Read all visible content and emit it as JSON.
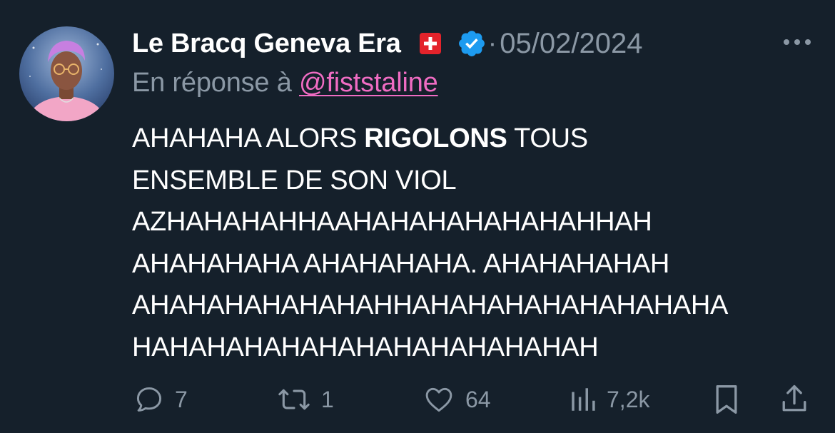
{
  "user": {
    "display_name": "Le Bracq Geneva Era",
    "flag_emoji": "🇨🇭",
    "verified": true,
    "date": "05/02/2024",
    "separator": "·"
  },
  "reply": {
    "prefix": "En réponse à ",
    "mention": "@fiststaline"
  },
  "text": {
    "line1_a": "AHAHAHA ALORS ",
    "line1_bold": "RIGOLONS",
    "line1_b": " TOUS",
    "line2": "ENSEMBLE DE SON VIOL",
    "line3": "AZHAHAHAHHAAHAHAHAHAHAHAHHAH",
    "line4": "AHAHAHAHA AHAHAHAHA. AHAHAHAHAH",
    "line5": "AHAHAHAHAHAHAHHAHAHAHAHAHAHAHAHA",
    "line6": "HAHAHAHAHAHAHAHAHAHAHAHAH"
  },
  "actions": {
    "replies": "7",
    "retweets": "1",
    "likes": "64",
    "views": "7,2k"
  },
  "colors": {
    "background": "#15202b",
    "text_primary": "#ffffff",
    "text_secondary": "#8b98a5",
    "mention": "#f06cc3",
    "verified_badge": "#1d9bf0"
  },
  "icons": {
    "more": "more-horizontal-icon",
    "reply": "reply-icon",
    "retweet": "retweet-icon",
    "like": "heart-icon",
    "views": "views-icon",
    "bookmark": "bookmark-icon",
    "share": "share-icon"
  }
}
